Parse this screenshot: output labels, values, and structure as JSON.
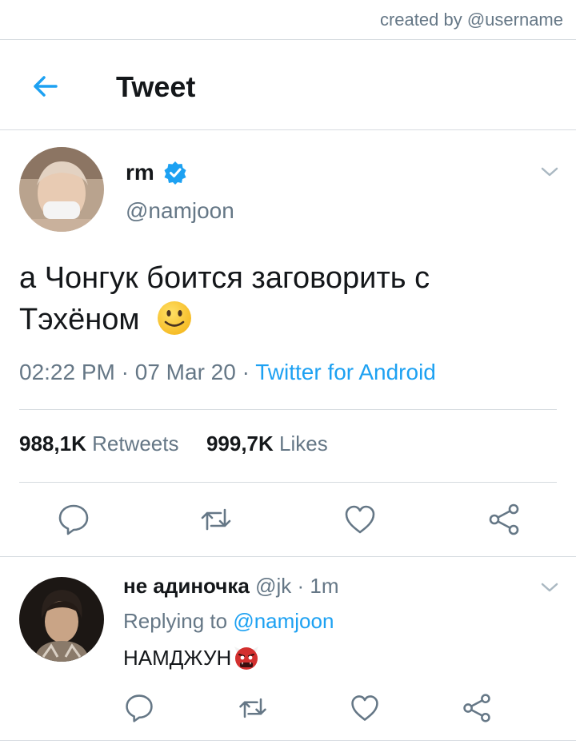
{
  "credit": "created by @username",
  "header": {
    "title": "Tweet",
    "back_icon": "arrow-left-icon"
  },
  "tweet": {
    "author": {
      "name": "rm",
      "handle": "@namjoon",
      "verified": true
    },
    "text": "а Чонгук боится заговорить с Тэхёном",
    "emoji": "slightly-smiling-face",
    "time": "02:22 PM",
    "date": "07 Mar 20",
    "source": "Twitter for Android",
    "retweets_count": "988,1K",
    "retweets_label": "Retweets",
    "likes_count": "999,7K",
    "likes_label": "Likes"
  },
  "reply": {
    "author": {
      "name": "не адиночка",
      "handle": "@jk",
      "time_ago": "1m"
    },
    "replying_prefix": "Replying to",
    "replying_to": "@namjoon",
    "text": "НАМДЖУН",
    "emoji": "ogre-mask"
  },
  "colors": {
    "accent": "#1da1f2",
    "muted": "#657786",
    "divider": "#d6dbe0",
    "text": "#14171a"
  }
}
